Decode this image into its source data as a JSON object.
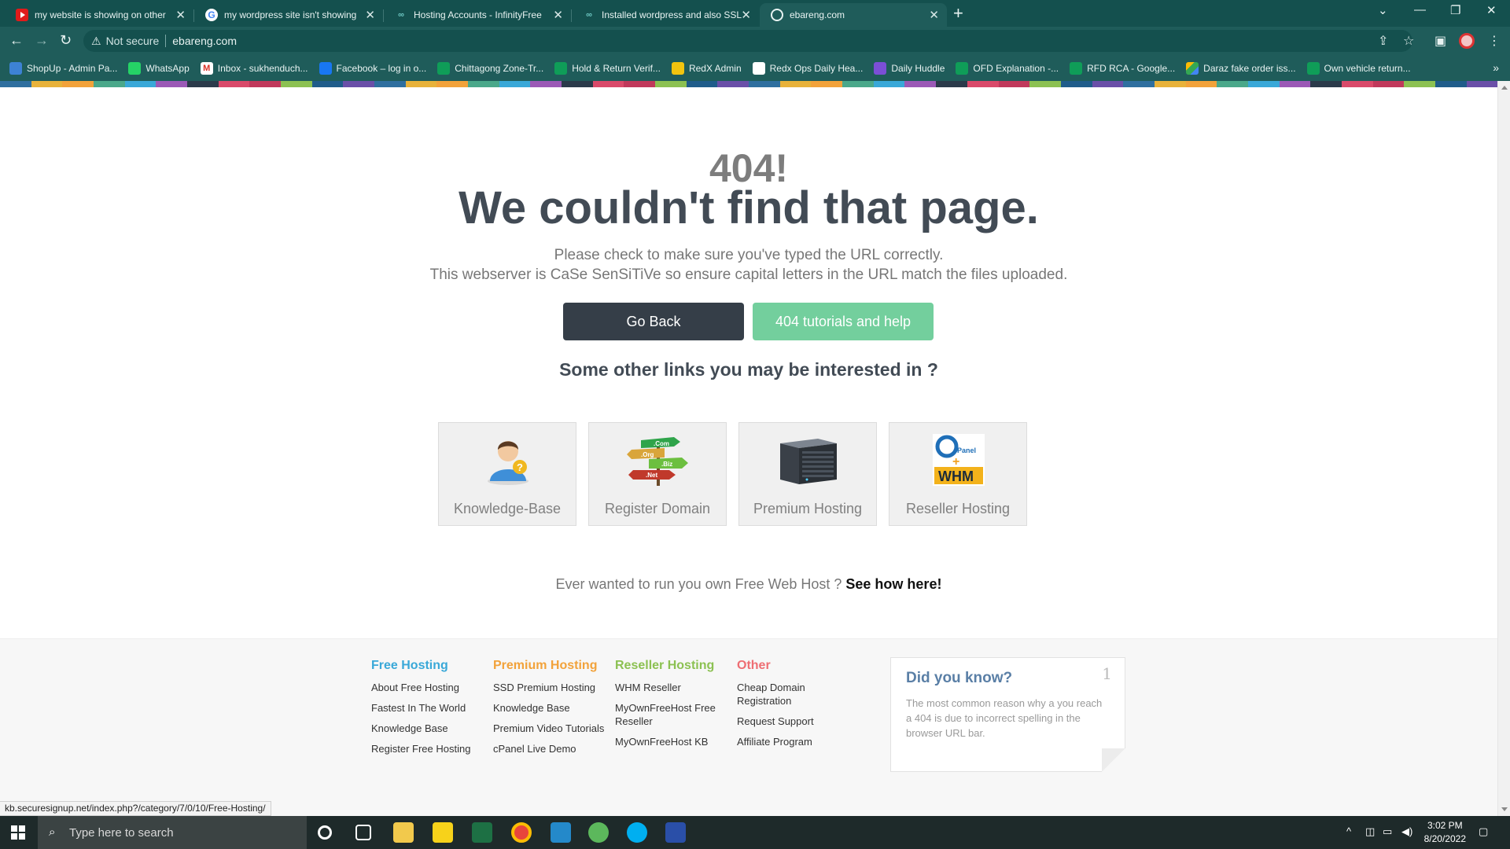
{
  "browser": {
    "tabs": [
      {
        "title": "my website is showing on other",
        "icon": "youtube-icon",
        "active": false
      },
      {
        "title": "my wordpress site isn't showing",
        "icon": "google-icon",
        "active": false
      },
      {
        "title": "Hosting Accounts - InfinityFree",
        "icon": "infinityfree-icon",
        "active": false
      },
      {
        "title": "Installed wordpress and also SSL",
        "icon": "infinityfree-icon",
        "active": false
      },
      {
        "title": "ebareng.com",
        "icon": "globe-icon",
        "active": true
      }
    ],
    "address": {
      "security_label": "Not secure",
      "url": "ebareng.com"
    },
    "bookmarks": [
      "ShopUp - Admin Pa...",
      "WhatsApp",
      "Inbox - sukhenduch...",
      "Facebook – log in o...",
      "Chittagong Zone-Tr...",
      "Hold & Return Verif...",
      "RedX Admin",
      "Redx Ops Daily Hea...",
      "Daily Huddle",
      "OFD Explanation -...",
      "RFD RCA - Google...",
      "Daraz fake order iss...",
      "Own vehicle return..."
    ]
  },
  "page": {
    "code": "404!",
    "heading": "We couldn't find that page.",
    "line1": "Please check to make sure you've typed the URL correctly.",
    "line2": "This webserver is CaSe SenSiTiVe so ensure capital letters in the URL match the files uploaded.",
    "go_back": "Go Back",
    "help": "404 tutorials and help",
    "interested": "Some other links you may be interested in ?",
    "cards": [
      {
        "label": "Knowledge-Base",
        "icon": "user-help-icon"
      },
      {
        "label": "Register Domain",
        "icon": "domain-signpost-icon"
      },
      {
        "label": "Premium Hosting",
        "icon": "server-icon"
      },
      {
        "label": "Reseller Hosting",
        "icon": "cpanel-whm-icon"
      }
    ],
    "freehost_text": "Ever wanted to run you own Free Web Host ?",
    "freehost_link": "See how here!"
  },
  "footer": {
    "columns": [
      {
        "title": "Free Hosting",
        "color": "#39a8d8",
        "links": [
          "About Free Hosting",
          "Fastest In The World",
          "Knowledge Base",
          "Register Free Hosting"
        ]
      },
      {
        "title": "Premium Hosting",
        "color": "#f2a23a",
        "links": [
          "SSD Premium Hosting",
          "Knowledge Base",
          "Premium Video Tutorials",
          "cPanel Live Demo"
        ]
      },
      {
        "title": "Reseller Hosting",
        "color": "#8cc152",
        "links": [
          "WHM Reseller",
          "MyOwnFreeHost Free Reseller",
          "MyOwnFreeHost KB"
        ]
      },
      {
        "title": "Other",
        "color": "#ee6e73",
        "links": [
          "Cheap Domain Registration",
          "Request Support",
          "Affiliate Program"
        ]
      }
    ],
    "did_you_know": {
      "title": "Did you know?",
      "number": "1",
      "text": "The most common reason why a you reach a 404 is due to incorrect spelling in the browser URL bar."
    }
  },
  "status_url": "kb.securesignup.net/index.php?/category/7/0/10/Free-Hosting/",
  "taskbar": {
    "search_placeholder": "Type here to search",
    "time": "3:02 PM",
    "date": "8/20/2022"
  },
  "colors": {
    "chrome_theme": "#1f5c5a",
    "heading": "#424b55",
    "go_back_bg": "#353e48",
    "help_bg": "#73cf9d"
  }
}
